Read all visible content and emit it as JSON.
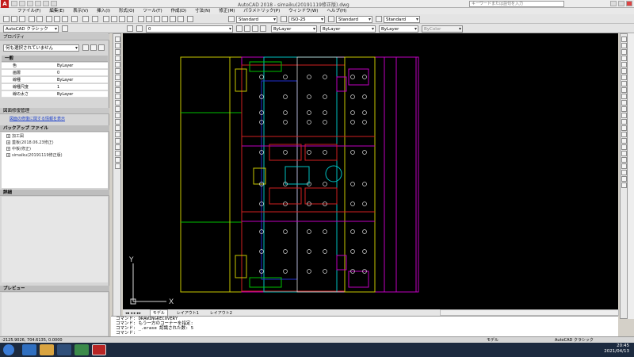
{
  "window": {
    "title": "AutoCAD 2018 - simaiku(20191119修正版).dwg",
    "search_placeholder": "キーワードまたは語句を入力"
  },
  "menu": {
    "items": [
      "ファイル(F)",
      "編集(E)",
      "表示(V)",
      "挿入(I)",
      "形式(O)",
      "ツール(T)",
      "作成(D)",
      "寸法(N)",
      "修正(M)",
      "パラメトリック(P)",
      "ウィンドウ(W)",
      "ヘルプ(H)"
    ]
  },
  "toolbar": {
    "style1": "Standard",
    "dimstyle": "ISO-25",
    "style3": "Standard",
    "style4": "Standard"
  },
  "toolbar2": {
    "workspace": "AutoCAD クラシック",
    "layer": "0",
    "color": "ByLayer",
    "linetype": "ByLayer",
    "lineweight": "ByLayer",
    "plotstyle": "ByColor"
  },
  "properties": {
    "title": "プロパティ",
    "selection": "何も選択されていません",
    "section": "一般",
    "rows": [
      {
        "k": "色",
        "v": "ByLayer"
      },
      {
        "k": "画層",
        "v": "0"
      },
      {
        "k": "線種",
        "v": "ByLayer"
      },
      {
        "k": "線種尺度",
        "v": "1"
      },
      {
        "k": "線の太さ",
        "v": "ByLayer"
      }
    ]
  },
  "drawing_recovery": {
    "title": "図面修復管理",
    "link": "図面の修復に関する情報を表示",
    "backup_header": "バックアップ ファイル",
    "files": [
      "加工図",
      "蓋板(2018.06.23修正)",
      "中板(修正)",
      "simaiku(20191119修正版)"
    ],
    "details": "詳細",
    "preview": "プレビュー"
  },
  "tabs": {
    "model": "モデル",
    "layout1": "レイアウト1",
    "layout2": "レイアウト2"
  },
  "commandline": {
    "lines": [
      "コマンド: DRAWINGRECOVERY",
      "コマンド: もう一方のコーナーを指定:",
      "コマンド: _.erase 認識された数: 5",
      "コマンド:"
    ]
  },
  "status": {
    "coords": "-2125.9026, 704.6135, 0.0000",
    "model": "モデル",
    "workspace": "AutoCAD クラシック"
  },
  "ucs": {
    "x": "X",
    "y": "Y"
  },
  "clock": {
    "time": "20:45",
    "date": "2021/04/13"
  },
  "colors": {
    "canvas": "#000000",
    "yellow": "#c8c800",
    "magenta": "#c000c0",
    "cyan": "#00c0c0",
    "blue": "#2030d0",
    "red": "#d02020",
    "green": "#00c000",
    "white": "#d8d8d8"
  }
}
